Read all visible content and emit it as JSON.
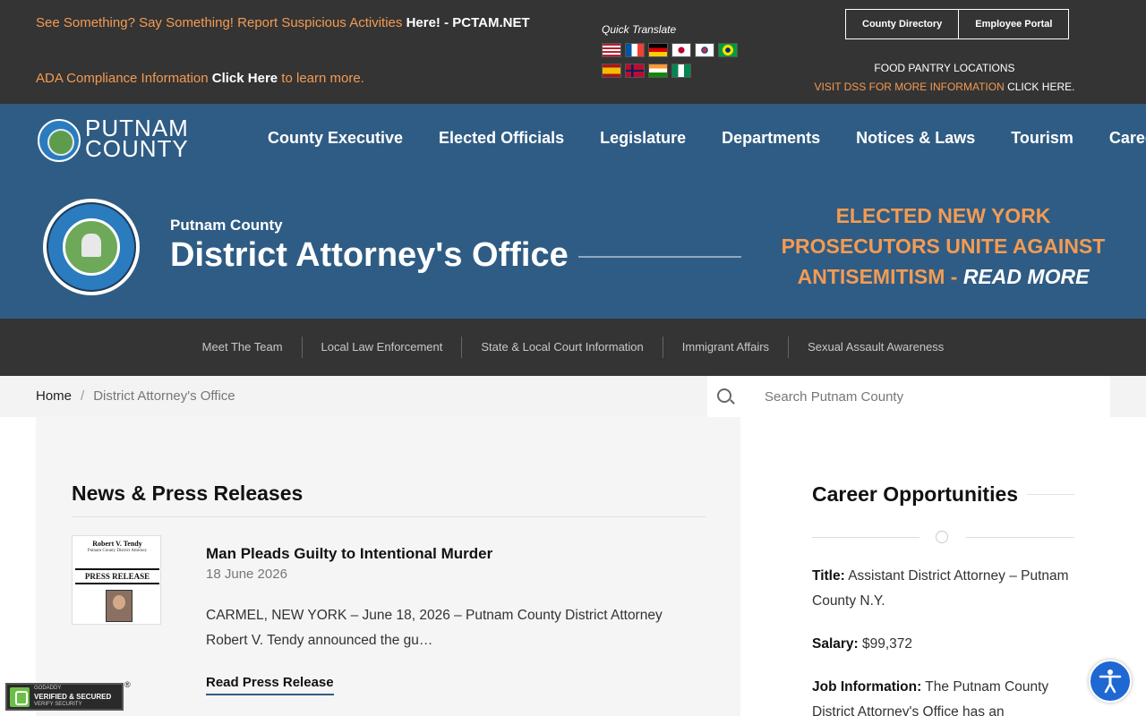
{
  "topbar": {
    "alert_prefix": "See Something? Say Something! Report Suspicious Activities ",
    "alert_bold": "Here! - PCTAM.NET",
    "ada_prefix": "ADA Compliance Information ",
    "ada_bold": "Click Here",
    "ada_suffix": " to learn more.",
    "quick_translate_label": "Quick Translate",
    "flags_row1": [
      "us-flag-icon",
      "france-flag-icon",
      "germany-flag-icon",
      "japan-flag-icon",
      "korea-flag-icon",
      "brazil-flag-icon"
    ],
    "flags_row2": [
      "spain-flag-icon",
      "norway-flag-icon",
      "india-flag-icon",
      "nigeria-flag-icon"
    ],
    "county_directory_label": "County Directory",
    "employee_portal_label": "Employee Portal",
    "food_pantry_title": "FOOD PANTRY LOCATIONS",
    "dss_prefix": "VISIT DSS FOR MORE INFORMATION ",
    "dss_link": "CLICK HERE",
    "dss_suffix": "."
  },
  "header": {
    "logo_line1": "PUTNAM",
    "logo_line2": "COUNTY",
    "nav": [
      "County Executive",
      "Elected Officials",
      "Legislature",
      "Departments",
      "Notices & Laws",
      "Tourism",
      "Careers"
    ]
  },
  "hero": {
    "subtitle": "Putnam County",
    "title": "District Attorney's Office",
    "callout_text": "ELECTED NEW YORK PROSECUTORS UNITE AGAINST ANTISEMITISM - ",
    "callout_link": "READ MORE"
  },
  "subnav": [
    "Meet The Team",
    "Local Law Enforcement",
    "State & Local Court Information",
    "Immigrant Affairs",
    "Sexual Assault Awareness"
  ],
  "breadcrumb": {
    "home": "Home",
    "separator": "/",
    "current": "District Attorney's Office"
  },
  "search": {
    "placeholder": "Search Putnam County"
  },
  "news": {
    "heading": "News & Press Releases",
    "thumb_name": "Robert V. Tendy",
    "thumb_title": "Putnam County District Attorney",
    "thumb_label": "PRESS RELEASE",
    "item_title": "Man Pleads Guilty to Intentional Murder",
    "item_date": "18 June 2026",
    "item_excerpt": "CARMEL, NEW YORK – June 18, 2026 – Putnam County District Attorney Robert V. Tendy announced the gu…",
    "read_more": "Read Press Release"
  },
  "careers": {
    "heading": "Career Opportunities",
    "title_label": "Title:",
    "title_value": " Assistant District Attorney – Putnam County N.Y.",
    "salary_label": "Salary:",
    "salary_value": " $99,372",
    "job_label": "Job Information:",
    "job_value": " The Putnam County District Attorney's Office has an"
  },
  "badge": {
    "line1": "GODADDY",
    "line2": "VERIFIED & SECURED",
    "line3": "VERIFY SECURITY",
    "reg": "®"
  },
  "colors": {
    "topbar_bg": "#343434",
    "hero_bg": "#2f5c84",
    "accent_orange": "#f39b52",
    "a11y_blue": "#1f67d2"
  }
}
